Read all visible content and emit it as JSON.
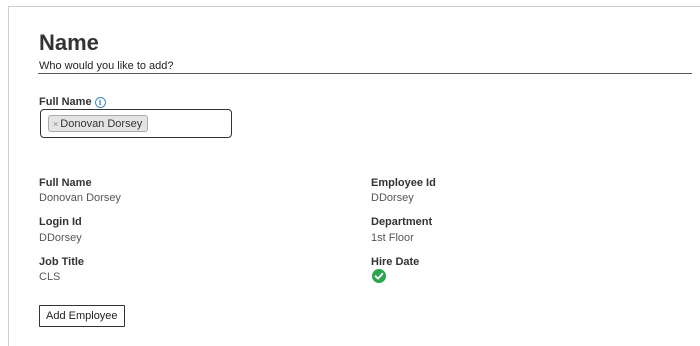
{
  "section": {
    "title": "Name",
    "subtitle": "Who would you like to add?"
  },
  "full_name_field": {
    "label": "Full Name",
    "info_icon": "info-icon",
    "token": {
      "remove_glyph": "×",
      "text": "Donovan Dorsey"
    }
  },
  "details": {
    "full_name": {
      "label": "Full Name",
      "value": "Donovan Dorsey"
    },
    "login_id": {
      "label": "Login Id",
      "value": "DDorsey"
    },
    "job_title": {
      "label": "Job Title",
      "value": "CLS"
    },
    "employee_id": {
      "label": "Employee Id",
      "value": "DDorsey"
    },
    "department": {
      "label": "Department",
      "value": "1st Floor"
    },
    "hire_date": {
      "label": "Hire Date",
      "icon": "check-circle-icon"
    }
  },
  "actions": {
    "add_employee_label": "Add Employee"
  },
  "colors": {
    "accent_info": "#3b87c4",
    "success": "#2ea44f"
  }
}
